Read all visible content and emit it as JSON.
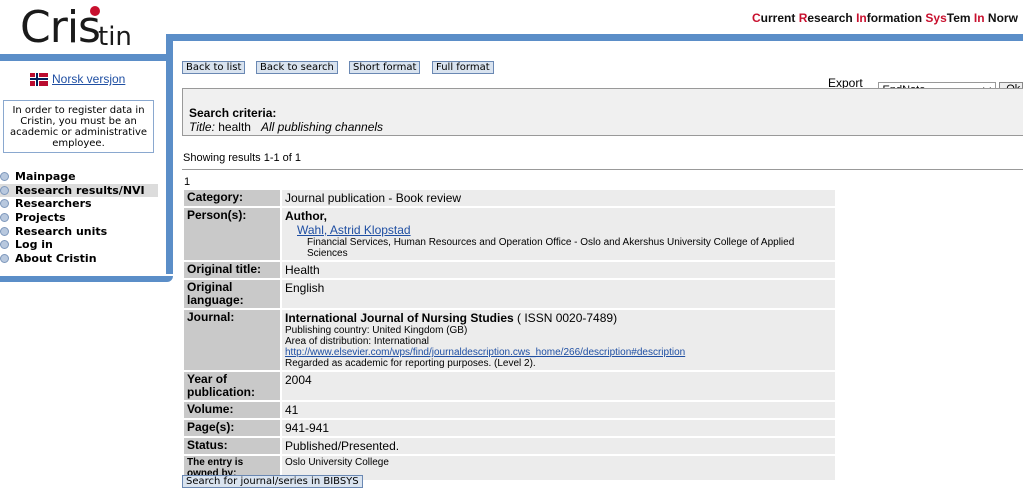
{
  "header": {
    "logo_cris": "Cris",
    "logo_tin": "tin",
    "tagline": [
      {
        "t": "C",
        "red": true
      },
      {
        "t": "urrent ",
        "red": false
      },
      {
        "t": "R",
        "red": true
      },
      {
        "t": "esearch ",
        "red": false
      },
      {
        "t": "In",
        "red": true
      },
      {
        "t": "formation ",
        "red": false
      },
      {
        "t": "Sys",
        "red": true
      },
      {
        "t": "T",
        "red": false
      },
      {
        "t": "em ",
        "red": false
      },
      {
        "t": "In",
        "red": true
      },
      {
        "t": " Norw",
        "red": false
      }
    ]
  },
  "sidebar": {
    "lang_link": "Norsk versjon",
    "info": "In order to register data in Cristin, you must be an academic or administrative employee.",
    "nav": [
      {
        "label": "Mainpage",
        "active": false
      },
      {
        "label": "Research results/NVI",
        "active": true
      },
      {
        "label": "Researchers",
        "active": false
      },
      {
        "label": "Projects",
        "active": false
      },
      {
        "label": "Research units",
        "active": false
      },
      {
        "label": "Log in",
        "active": false
      },
      {
        "label": "About Cristin",
        "active": false
      }
    ]
  },
  "toolbar": {
    "back_to_list": "Back to list",
    "back_to_search": "Back to search",
    "short_format": "Short format",
    "full_format": "Full format",
    "export_label": "Export to",
    "export_value": "EndNote",
    "export_ok": "Ok"
  },
  "criteria": {
    "header": "Search criteria:",
    "title_label": "Title:",
    "title_value": "health",
    "channels": "All publishing channels"
  },
  "results": {
    "showing": "Showing results 1-1 of 1",
    "number": "1"
  },
  "record": {
    "category_label": "Category:",
    "category_value": "Journal publication - Book review",
    "persons_label": "Person(s):",
    "author_role": "Author,",
    "author_name": "Wahl, Astrid Klopstad",
    "author_affiliation": "Financial Services, Human Resources and Operation Office - Oslo and Akershus University College of Applied Sciences",
    "original_title_label": "Original title:",
    "original_title_value": "Health",
    "language_label": "Original language:",
    "language_value": "English",
    "journal_label": "Journal:",
    "journal_name": "International Journal of Nursing Studies",
    "journal_issn": " ( ISSN 0020-7489)",
    "publishing_country": "Publishing country: United Kingdom (GB)",
    "distribution": "Area of distribution: International",
    "journal_url": "http://www.elsevier.com/wps/find/journaldescription.cws_home/266/description#description",
    "academic_note": "Regarded as academic for reporting purposes. (Level 2).",
    "year_label": "Year of publication:",
    "year_value": "2004",
    "volume_label": "Volume:",
    "volume_value": "41",
    "pages_label": "Page(s):",
    "pages_value": "941-941",
    "status_label": "Status:",
    "status_value": "Published/Presented.",
    "owner_label": "The entry is owned by:",
    "owner_value": "Oslo University College"
  },
  "footer": {
    "bibsys_button": "Search for journal/series in BIBSYS"
  }
}
